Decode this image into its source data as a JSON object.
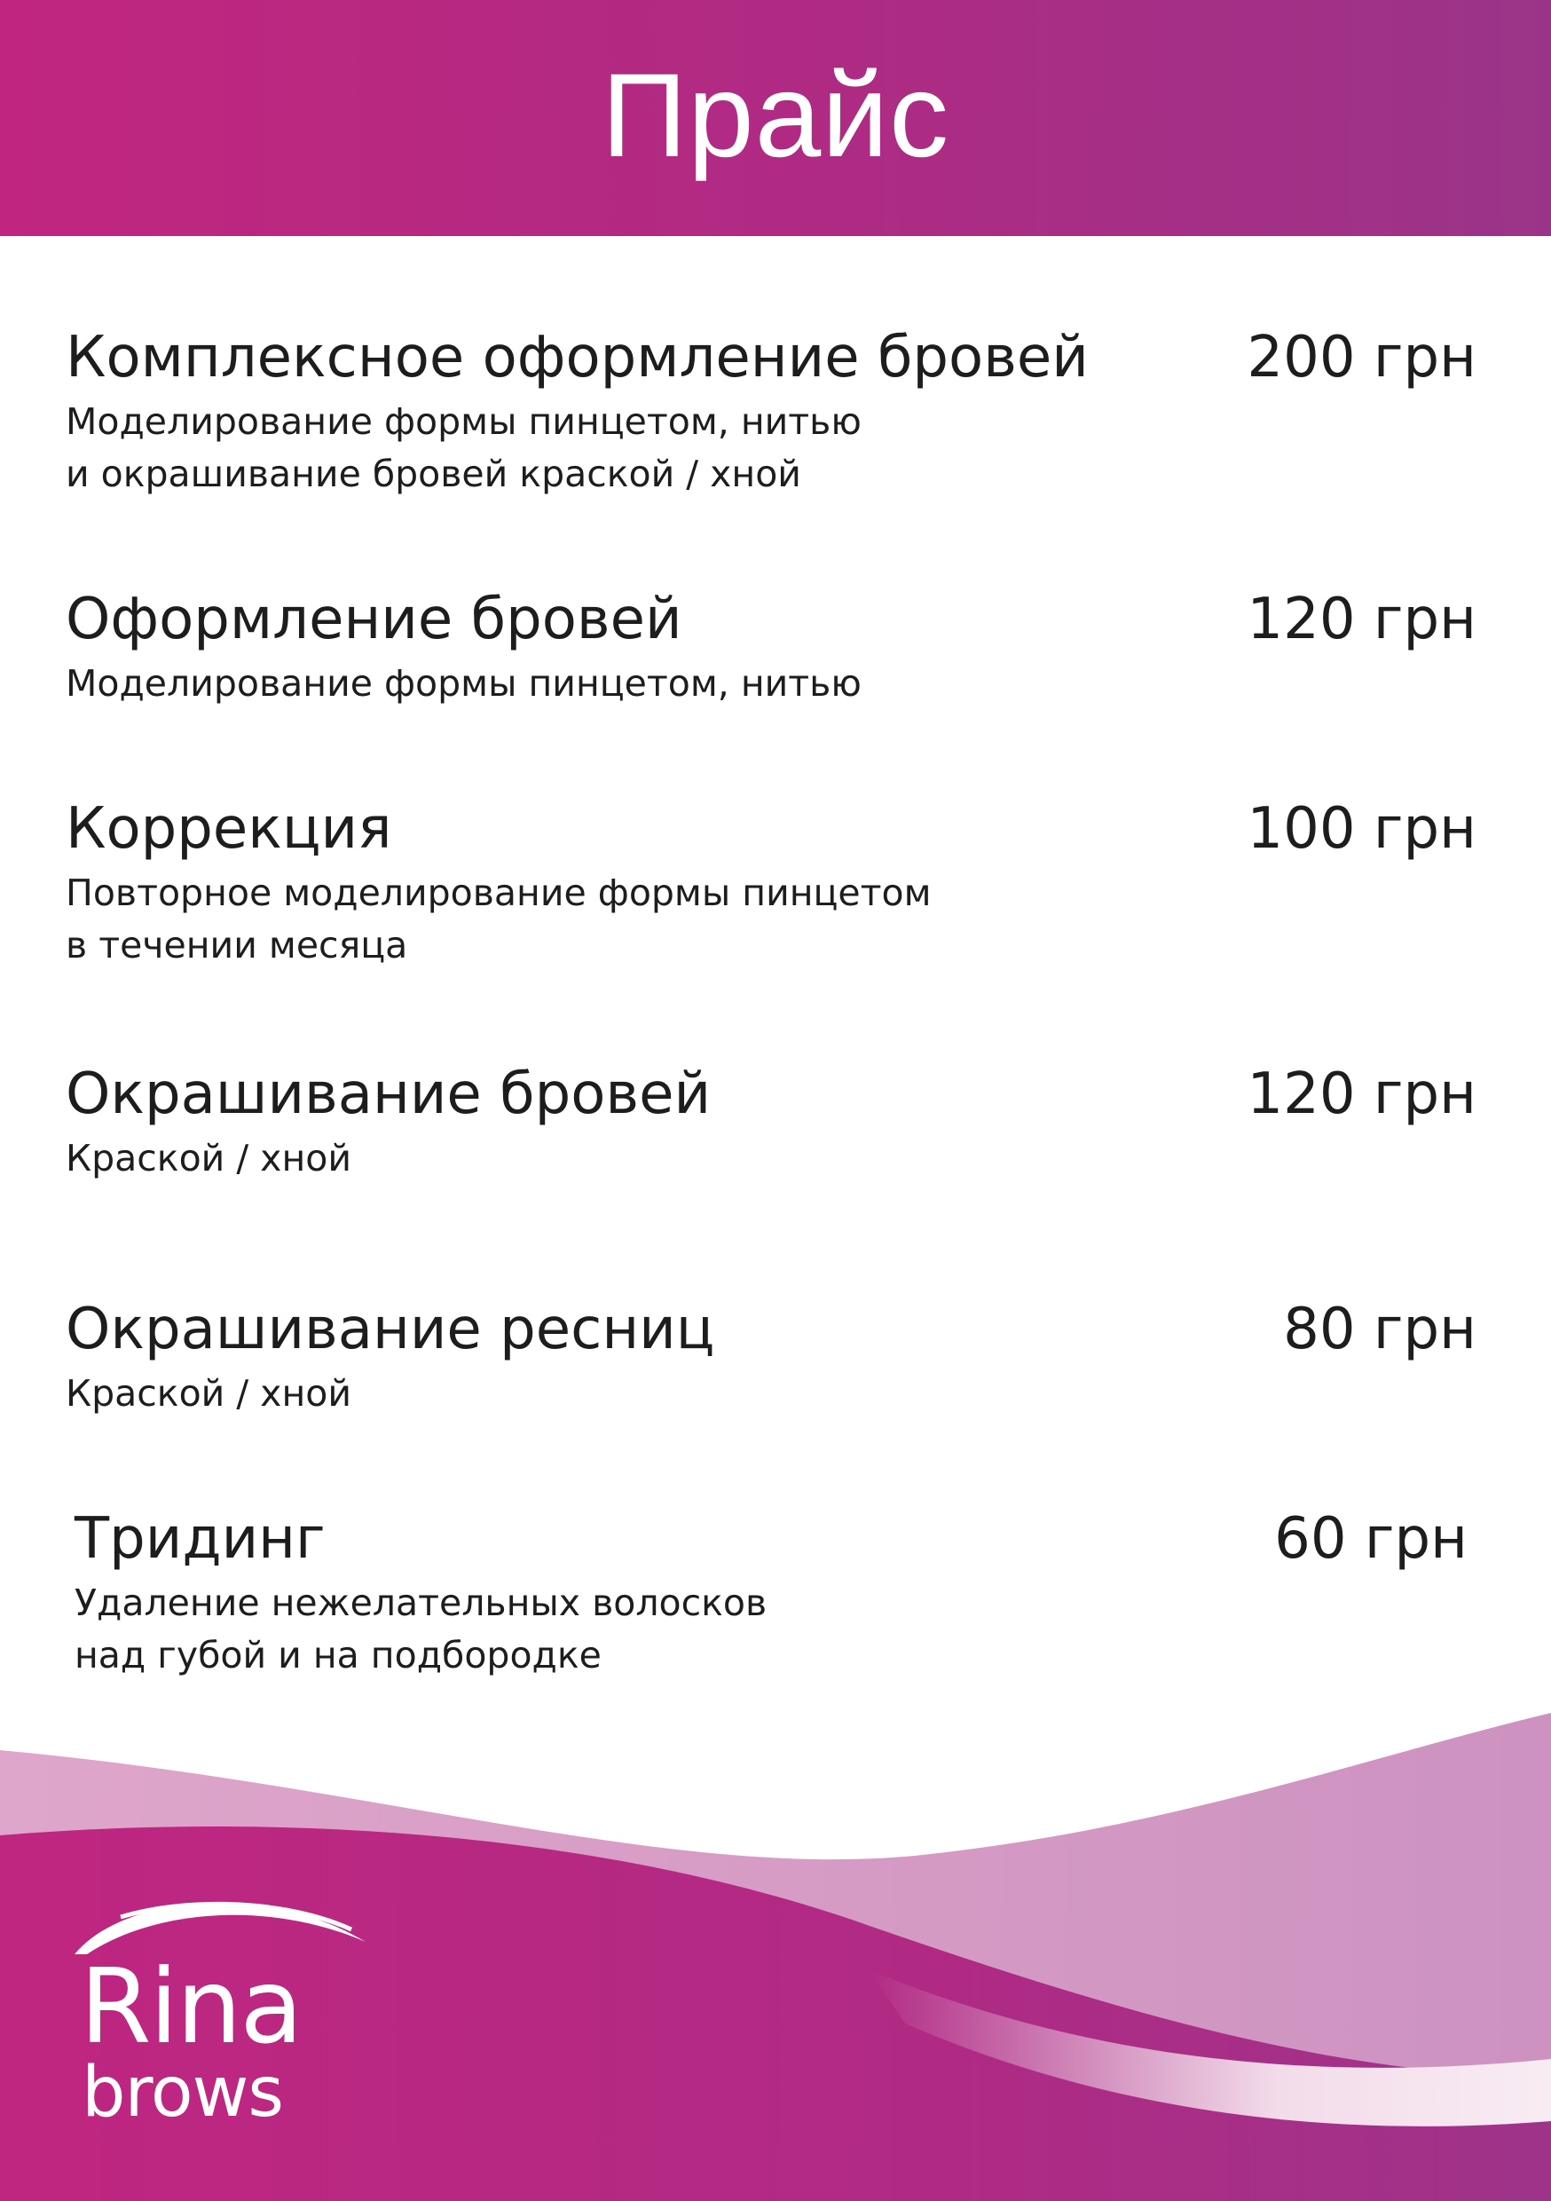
{
  "header": {
    "title": "Прайс"
  },
  "services": [
    {
      "name": "Комплексное оформление бровей",
      "price": "200 грн",
      "description": [
        "Моделирование формы пинцетом, нитью",
        "и окрашивание бровей краской / хной"
      ]
    },
    {
      "name": "Оформление бровей",
      "price": "120 грн",
      "description": [
        "Моделирование формы пинцетом, нитью"
      ]
    },
    {
      "name": "Коррекция",
      "price": "100 грн",
      "description": [
        "Повторное моделирование формы пинцетом",
        "в течении месяца"
      ]
    },
    {
      "name": "Окрашивание бровей",
      "price": "120 грн",
      "description": [
        "Краской / хной"
      ]
    },
    {
      "name": "Окрашивание ресниц",
      "price": "80 грн",
      "description": [
        "Краской / хной"
      ]
    },
    {
      "name": "Тридинг",
      "price": "60 грн",
      "description": [
        "Удаление нежелательных волосков",
        "над губой и на подбородке"
      ]
    }
  ],
  "brand": {
    "name": "Rina",
    "subname": "brows",
    "icon": "brow-arc-icon"
  },
  "colors": {
    "primary": "#c0267f",
    "secondary": "#9b3488",
    "wave_light": "#d595c0",
    "text": "#1d1d1d"
  }
}
